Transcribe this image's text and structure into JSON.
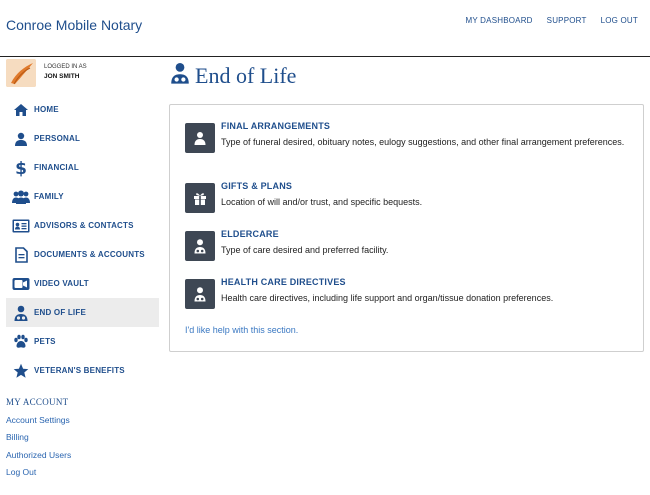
{
  "header": {
    "brand": "Conroe Mobile Notary",
    "nav": [
      {
        "label": "MY DASHBOARD"
      },
      {
        "label": "SUPPORT"
      },
      {
        "label": "LOG OUT"
      }
    ]
  },
  "user": {
    "logged_in_label": "LOGGED IN AS",
    "name": "JON SMITH"
  },
  "sidebar": {
    "items": [
      {
        "label": "HOME",
        "icon": "home-icon"
      },
      {
        "label": "PERSONAL",
        "icon": "person-icon"
      },
      {
        "label": "FINANCIAL",
        "icon": "dollar-icon"
      },
      {
        "label": "FAMILY",
        "icon": "family-icon"
      },
      {
        "label": "ADVISORS & CONTACTS",
        "icon": "contact-card-icon"
      },
      {
        "label": "DOCUMENTS & ACCOUNTS",
        "icon": "document-icon"
      },
      {
        "label": "VIDEO VAULT",
        "icon": "video-icon"
      },
      {
        "label": "END OF LIFE",
        "icon": "doctor-icon"
      },
      {
        "label": "PETS",
        "icon": "paw-icon"
      },
      {
        "label": "VETERAN'S BENEFITS",
        "icon": "star-icon"
      }
    ]
  },
  "account": {
    "title": "MY ACCOUNT",
    "links": [
      {
        "label": "Account Settings"
      },
      {
        "label": "Billing"
      },
      {
        "label": "Authorized Users"
      },
      {
        "label": "Log Out"
      }
    ]
  },
  "main": {
    "title": "End of Life",
    "sections": [
      {
        "title": "FINAL ARRANGEMENTS",
        "desc": "Type of funeral desired, obituary notes, eulogy suggestions, and other final arrangement preferences.",
        "icon": "person-bust-icon"
      },
      {
        "title": "GIFTS & PLANS",
        "desc": "Location of will and/or trust, and specific bequests.",
        "icon": "gift-icon"
      },
      {
        "title": "ELDERCARE",
        "desc": "Type of care desired and preferred facility.",
        "icon": "doctor-icon"
      },
      {
        "title": "HEALTH CARE DIRECTIVES",
        "desc": "Health care directives, including life support and organ/tissue donation preferences.",
        "icon": "doctor-icon"
      }
    ],
    "help_link": "I'd like help with this section."
  },
  "colors": {
    "brand_blue": "#1f4e8c",
    "link_blue": "#3a78c2",
    "icon_bg": "#3e4754",
    "active_bg": "#ececec"
  }
}
